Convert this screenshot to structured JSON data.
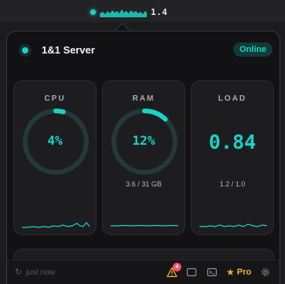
{
  "menubar": {
    "value": "1.4",
    "icon": "status-dot-icon"
  },
  "server": {
    "name": "1&1 Server",
    "status": "Online"
  },
  "cards": [
    {
      "label": "CPU",
      "value": "4%",
      "percent": 4
    },
    {
      "label": "RAM",
      "value": "12%",
      "percent": 12,
      "sub": "3.6 / 31 GB"
    },
    {
      "label": "LOAD",
      "value": "0.84",
      "sub": "1.2 / 1.0"
    }
  ],
  "footer": {
    "refresh_text": "just now",
    "alert_count": "4",
    "pro_label": "Pro",
    "icons": [
      "refresh-icon",
      "warning-icon",
      "window-icon",
      "terminal-icon",
      "star-icon",
      "gear-icon"
    ]
  },
  "colors": {
    "accent": "#19d3c5",
    "badge": "#ff4d6a",
    "pro": "#f0b429",
    "background": "#121214"
  }
}
